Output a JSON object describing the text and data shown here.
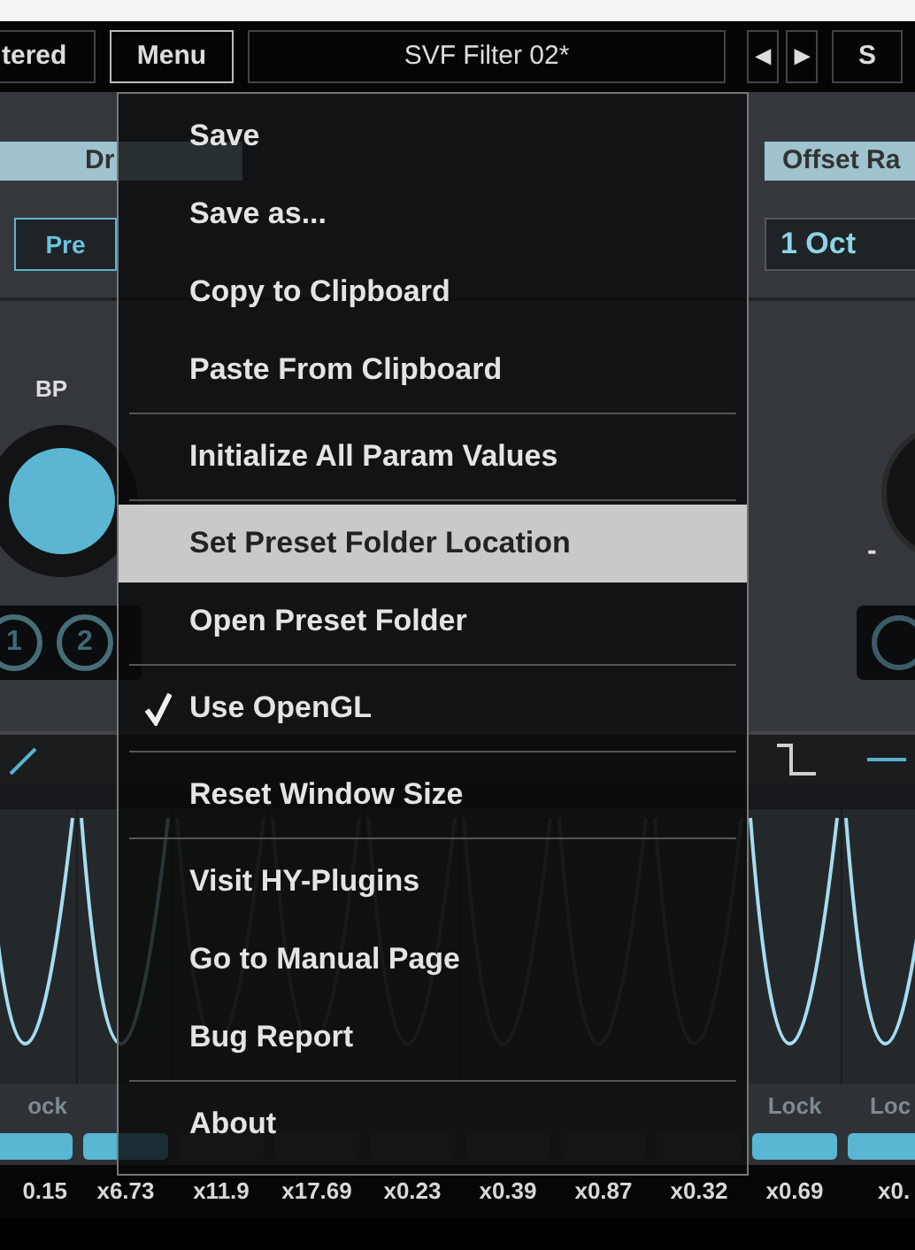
{
  "top_bar": {
    "prev_button_label": "tered",
    "menu_button": {
      "label": "Menu",
      "selected": true
    },
    "preset_name": "SVF Filter 02*",
    "prev_arrow": "◀",
    "next_arrow": "▶",
    "next_button_label": "S"
  },
  "labels": {
    "left": "Dr",
    "right": "Offset Ra"
  },
  "mode_row": {
    "pre": {
      "label": "Pre",
      "selected": true
    },
    "offset_value": "1 Oct"
  },
  "filter_type": "BP",
  "knob_minus": "-",
  "mod_slots": [
    {
      "label": "1",
      "on": true
    },
    {
      "label": "2",
      "on": true
    }
  ],
  "menu": {
    "groups": [
      [
        {
          "label": "Save",
          "selected": false,
          "checked": false
        },
        {
          "label": "Save as...",
          "selected": false,
          "checked": false
        },
        {
          "label": "Copy to Clipboard",
          "selected": false,
          "checked": false
        },
        {
          "label": "Paste From Clipboard",
          "selected": false,
          "checked": false
        }
      ],
      [
        {
          "label": "Initialize All Param Values",
          "selected": false,
          "checked": false
        }
      ],
      [
        {
          "label": "Set Preset Folder Location",
          "selected": true,
          "checked": false
        },
        {
          "label": "Open Preset Folder",
          "selected": false,
          "checked": false
        }
      ],
      [
        {
          "label": "Use OpenGL",
          "selected": false,
          "checked": true
        }
      ],
      [
        {
          "label": "Reset Window Size",
          "selected": false,
          "checked": false
        }
      ],
      [
        {
          "label": "Visit HY-Plugins",
          "selected": false,
          "checked": false
        },
        {
          "label": "Go to Manual Page",
          "selected": false,
          "checked": false
        },
        {
          "label": "Bug Report",
          "selected": false,
          "checked": false
        }
      ],
      [
        {
          "label": "About",
          "selected": false,
          "checked": false
        }
      ]
    ]
  },
  "steps": [
    {
      "lock": "ock",
      "value": "0.15",
      "active": true
    },
    {
      "value": "x6.73",
      "active": true
    },
    {
      "value": "x11.9",
      "active": false
    },
    {
      "value": "x17.69",
      "active": false
    },
    {
      "value": "x0.23",
      "active": false
    },
    {
      "value": "x0.39",
      "active": false
    },
    {
      "value": "x0.87",
      "active": false
    },
    {
      "value": "x0.32",
      "active": false
    },
    {
      "lock": "Lock",
      "value": "x0.69",
      "active": true
    },
    {
      "lock": "Loc",
      "value": "x0.",
      "active": true
    }
  ]
}
